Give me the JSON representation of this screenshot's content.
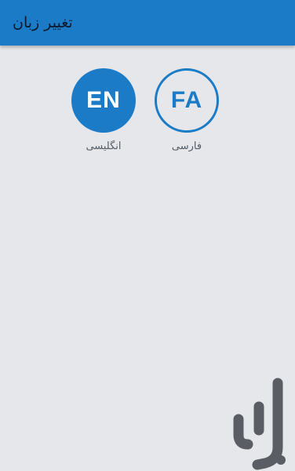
{
  "app_bar": {
    "title": "تغییر زبان",
    "color": "#1b7bc6"
  },
  "languages": [
    {
      "code": "EN",
      "label": "انگلیسی",
      "style": "filled"
    },
    {
      "code": "FA",
      "label": "فارسی",
      "style": "outlined"
    }
  ],
  "watermark": {
    "icon": "store-logo-icon",
    "color": "#5a5d63"
  }
}
